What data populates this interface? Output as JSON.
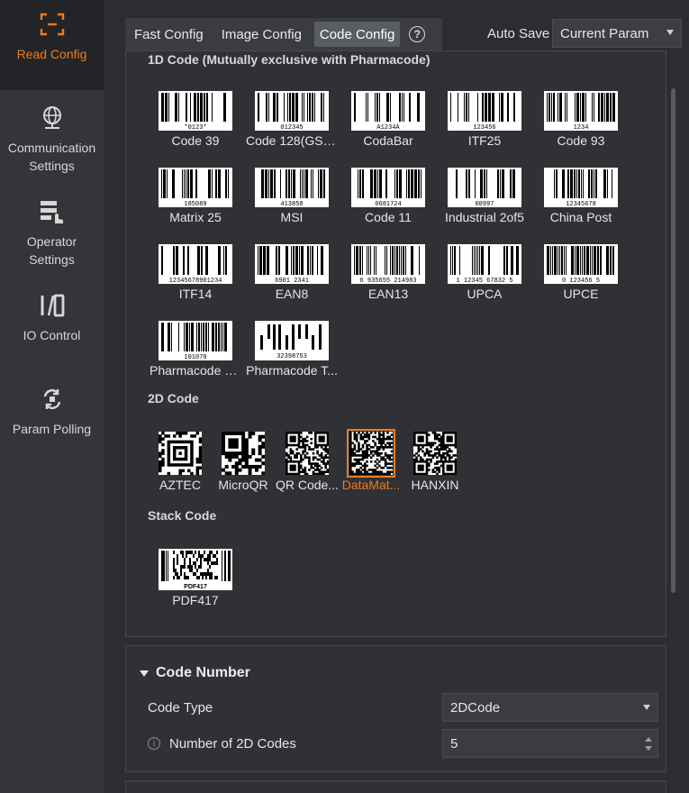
{
  "sidebar": {
    "items": [
      {
        "label": "Read Config",
        "icon": "scan-icon"
      },
      {
        "label": "Communication Settings",
        "icon": "globe-network-icon"
      },
      {
        "label": "Operator Settings",
        "icon": "operator-hand-icon"
      },
      {
        "label": "IO Control",
        "icon": "io-icon"
      },
      {
        "label": "Param Polling",
        "icon": "polling-icon"
      }
    ]
  },
  "topbar": {
    "tabs": [
      "Fast Config",
      "Image Config",
      "Code Config"
    ],
    "help": "?",
    "autosave_label": "Auto Save",
    "param_select": "Current Param"
  },
  "sections": {
    "one_d": "1D Code (Mutually exclusive with Pharmacode)",
    "two_d": "2D Code",
    "stack": "Stack Code"
  },
  "codes_1d": [
    {
      "name": "Code 39",
      "caption": "*0123*"
    },
    {
      "name": "Code 128(GS1...",
      "caption": "012345"
    },
    {
      "name": "CodaBar",
      "caption": "A1234A"
    },
    {
      "name": "ITF25",
      "caption": "123456"
    },
    {
      "name": "Code 93",
      "caption": "1234"
    },
    {
      "name": "Matrix 25",
      "caption": "185089"
    },
    {
      "name": "MSI",
      "caption": "413858"
    },
    {
      "name": "Code 11",
      "caption": "0681724"
    },
    {
      "name": "Industrial 2of5",
      "caption": "00997"
    },
    {
      "name": "China Post",
      "caption": "12345678"
    },
    {
      "name": "ITF14",
      "caption": "12345678901234"
    },
    {
      "name": "EAN8",
      "caption": "6901 2341"
    },
    {
      "name": "EAN13",
      "caption": "6 935655 214983"
    },
    {
      "name": "UPCA",
      "caption": "1 12345 67832 5"
    },
    {
      "name": "UPCE",
      "caption": "0 123456 5"
    },
    {
      "name": "Pharmacode O...",
      "caption": "101070"
    },
    {
      "name": "Pharmacode T...",
      "caption": "32398753"
    }
  ],
  "codes_2d": [
    {
      "name": "AZTEC"
    },
    {
      "name": "MicroQR"
    },
    {
      "name": "QR Code..."
    },
    {
      "name": "DataMat...",
      "selected": true
    },
    {
      "name": "HANXIN"
    }
  ],
  "codes_stack": [
    {
      "name": "PDF417",
      "caption": "PDF417"
    }
  ],
  "code_number": {
    "title": "Code Number",
    "code_type_label": "Code Type",
    "code_type_value": "2DCode",
    "info": "i",
    "count_label": "Number of 2D Codes",
    "count_value": "5"
  },
  "colors": {
    "accent": "#f07b1d",
    "background": "#2b2d31",
    "sidebar": "#333539"
  }
}
